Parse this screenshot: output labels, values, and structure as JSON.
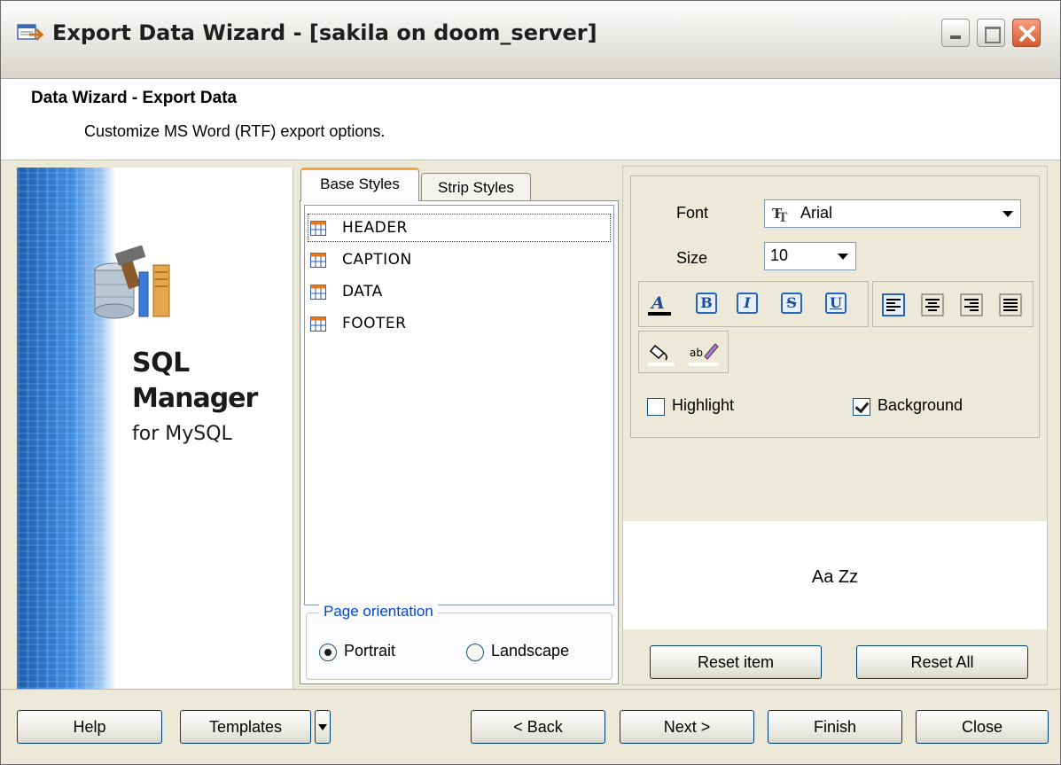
{
  "window": {
    "title": "Export Data Wizard - [sakila on doom_server]"
  },
  "header": {
    "title": "Data Wizard - Export Data",
    "subtitle": "Customize MS Word (RTF) export options."
  },
  "banner": {
    "line1": "SQL",
    "line2": "Manager",
    "line3": "for MySQL"
  },
  "tabs": [
    {
      "label": "Base Styles",
      "active": true
    },
    {
      "label": "Strip Styles",
      "active": false
    }
  ],
  "style_items": [
    {
      "label": "HEADER",
      "selected": true
    },
    {
      "label": "CAPTION",
      "selected": false
    },
    {
      "label": "DATA",
      "selected": false
    },
    {
      "label": "FOOTER",
      "selected": false
    }
  ],
  "page_orientation": {
    "title": "Page orientation",
    "options": [
      {
        "label": "Portrait",
        "checked": true
      },
      {
        "label": "Landscape",
        "checked": false
      }
    ]
  },
  "font": {
    "label": "Font",
    "value": "Arial",
    "size_label": "Size",
    "size_value": "10"
  },
  "format_buttons": {
    "bold": "B",
    "italic": "I",
    "strike": "S",
    "underline": "U"
  },
  "checkboxes": {
    "highlight": {
      "label": "Highlight",
      "checked": false
    },
    "background": {
      "label": "Background",
      "checked": true
    }
  },
  "preview": {
    "text": "Aa Zz"
  },
  "reset": {
    "item": "Reset item",
    "all": "Reset All"
  },
  "footer_buttons": {
    "help": "Help",
    "templates": "Templates",
    "back": "< Back",
    "next": "Next >",
    "finish": "Finish",
    "close": "Close"
  },
  "colors": {
    "tab_accent": "#f1a53b",
    "group_title": "#0046d5",
    "format_button": "#2b63b9"
  }
}
